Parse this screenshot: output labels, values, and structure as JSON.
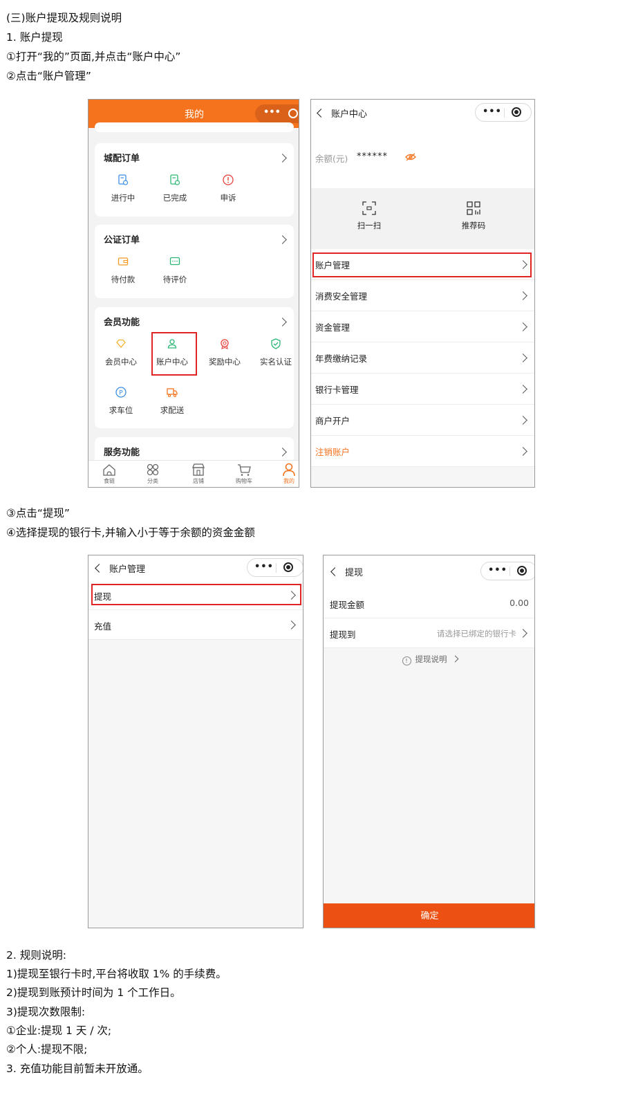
{
  "doc": {
    "heading": "(三)账户提现及规则说明",
    "s1_title": "1. 账户提现",
    "step1": "①打开“我的”页面,并点击“账户中心”",
    "step2": "②点击“账户管理”",
    "step3": "③点击“提现”",
    "step4": "④选择提现的银行卡,并输入小于等于余额的资金金额",
    "s2_title": "2. 规则说明:",
    "rule1": "1)提现至银行卡时,平台将收取 1% 的手续费。",
    "rule2": "2)提现到账预计时间为 1 个工作日。",
    "rule3": "3)提现次数限制:",
    "rule3a": "①企业:提现 1 天 / 次;",
    "rule3b": "②个人:提现不限;",
    "rule4": "3. 充值功能目前暂未开放通。"
  },
  "colors": {
    "accent": "#f5731d",
    "confirm": "#ec5113",
    "highlight": "#e02424"
  },
  "mine": {
    "title": "我的",
    "card1": {
      "title": "城配订单",
      "items": [
        {
          "label": "进行中",
          "icon": "doc-clock-icon"
        },
        {
          "label": "已完成",
          "icon": "doc-check-icon"
        },
        {
          "label": "申诉",
          "icon": "alert-circle-icon"
        }
      ]
    },
    "card2": {
      "title": "公证订单",
      "items": [
        {
          "label": "待付款",
          "icon": "wallet-icon"
        },
        {
          "label": "待评价",
          "icon": "comment-icon"
        }
      ]
    },
    "card3": {
      "title": "会员功能",
      "items": [
        {
          "label": "会员中心",
          "icon": "diamond-icon"
        },
        {
          "label": "账户中心",
          "icon": "user-icon"
        },
        {
          "label": "奖励中心",
          "icon": "medal-icon"
        },
        {
          "label": "实名认证",
          "icon": "shield-check-icon"
        },
        {
          "label": "求车位",
          "icon": "parking-icon"
        },
        {
          "label": "求配送",
          "icon": "truck-icon"
        }
      ]
    },
    "card4": {
      "title": "服务功能"
    },
    "tabs": [
      {
        "label": "食链",
        "icon": "home-icon"
      },
      {
        "label": "分类",
        "icon": "category-icon"
      },
      {
        "label": "店铺",
        "icon": "shop-icon"
      },
      {
        "label": "购物车",
        "icon": "cart-icon"
      },
      {
        "label": "我的",
        "icon": "profile-icon"
      }
    ]
  },
  "account_center": {
    "title": "账户中心",
    "balance_label": "余额(元)",
    "balance_value": "******",
    "scan_label": "扫一扫",
    "recommend_label": "推荐码",
    "rows": [
      "账户管理",
      "消费安全管理",
      "资金管理",
      "年费缴纳记录",
      "银行卡管理",
      "商户开户",
      "注销账户"
    ]
  },
  "account_mgmt": {
    "title": "账户管理",
    "rows": [
      "提现",
      "充值"
    ]
  },
  "withdraw": {
    "title": "提现",
    "amount_label": "提现金额",
    "amount_value": "0.00",
    "to_label": "提现到",
    "to_placeholder": "请选择已绑定的银行卡",
    "explain": "提现说明",
    "confirm": "确定"
  }
}
